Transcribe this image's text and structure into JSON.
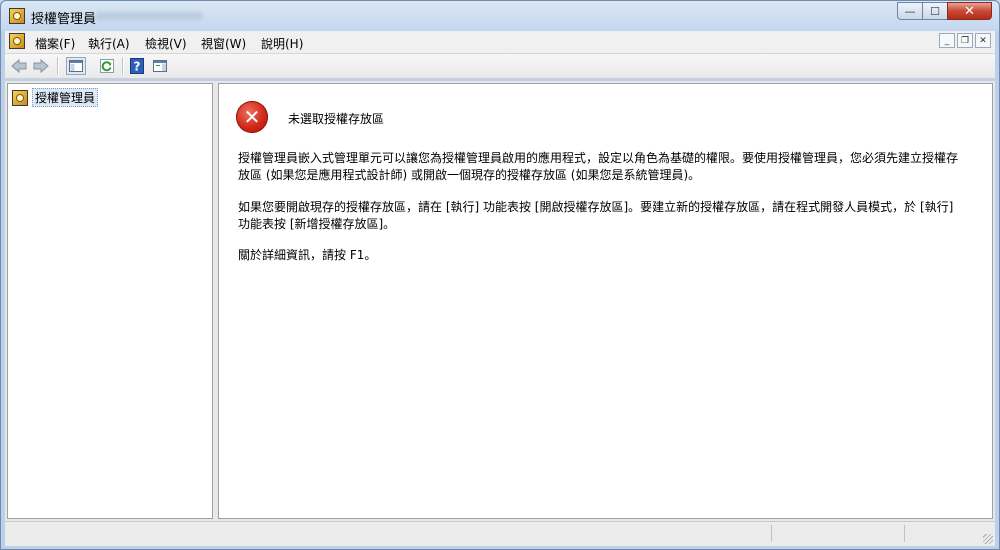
{
  "window": {
    "title": "授權管理員",
    "caption_buttons": {
      "minimize": "—",
      "maximize": "☐",
      "close": "✕"
    }
  },
  "menubar": {
    "items": [
      {
        "label": "檔案(F)"
      },
      {
        "label": "執行(A)"
      },
      {
        "label": "檢視(V)"
      },
      {
        "label": "視窗(W)"
      },
      {
        "label": "說明(H)"
      }
    ],
    "mdi_buttons": {
      "minimize": "_",
      "restore": "❐",
      "close": "✕"
    }
  },
  "toolbar": {
    "icons": [
      "back-arrow-icon",
      "forward-arrow-icon",
      "show-hide-console-tree-icon",
      "refresh-icon",
      "help-icon",
      "show-hide-action-pane-icon"
    ]
  },
  "tree": {
    "root_label": "授權管理員"
  },
  "content": {
    "heading": "未選取授權存放區",
    "paragraph1": "授權管理員嵌入式管理單元可以讓您為授權管理員啟用的應用程式，設定以角色為基礎的權限。要使用授權管理員，您必須先建立授權存放區 (如果您是應用程式設計師) 或開啟一個現存的授權存放區 (如果您是系統管理員)。",
    "paragraph2": "如果您要開啟現存的授權存放區，請在 [執行] 功能表按 [開啟授權存放區]。要建立新的授權存放區，請在程式開發人員模式，於 [執行] 功能表按 [新增授權存放區]。",
    "paragraph3": "關於詳細資訊，請按 F1。"
  },
  "colors": {
    "error_red": "#d0281a",
    "selection_bg": "#dfe9f6"
  }
}
